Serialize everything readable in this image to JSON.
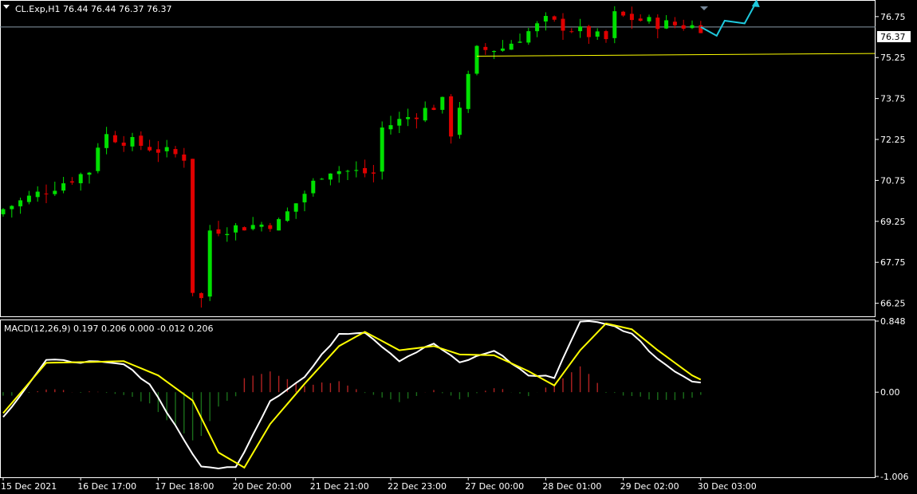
{
  "main_chart": {
    "header": "CL.Exp,H1  76.44 76.44 76.37 76.37",
    "price_axis_labels": [
      "76.75",
      "75.25",
      "73.75",
      "72.25",
      "70.75",
      "69.25",
      "67.75",
      "66.25"
    ],
    "current_price": "76.37",
    "current_price_badge_color": "#ffffff",
    "bid_line_color": "#8a9aa8",
    "support_line_color": "#ffff00",
    "forecast_arrow_color": "#1ec8dc"
  },
  "macd_panel": {
    "header": "MACD(12,26,9) 0.197 0.206 0.000 -0.012 0.206",
    "axis_labels": [
      "0.848",
      "0.00",
      "-1.006"
    ],
    "macd_line_color": "#ffffff",
    "signal_line_color": "#ffff00",
    "hist_positive_color": "#b22222",
    "hist_negative_color": "#1a6e1a"
  },
  "time_axis": {
    "labels": [
      "15 Dec 2021",
      "16 Dec 17:00",
      "17 Dec 18:00",
      "20 Dec 20:00",
      "21 Dec 21:00",
      "22 Dec 23:00",
      "27 Dec 00:00",
      "28 Dec 01:00",
      "29 Dec 02:00",
      "30 Dec 03:00"
    ]
  },
  "colors": {
    "background": "#000000",
    "bull_candle": "#00e000",
    "bear_candle": "#e00000",
    "axis": "#ffffff"
  },
  "chart_data": [
    {
      "type": "candlestick",
      "symbol": "CL.Exp",
      "timeframe": "H1",
      "title": "CL.Exp,H1",
      "ohlc_last": {
        "open": 76.44,
        "high": 76.44,
        "low": 76.37,
        "close": 76.37
      },
      "x_labels": [
        "15 Dec 2021",
        "16 Dec 17:00",
        "17 Dec 18:00",
        "20 Dec 20:00",
        "21 Dec 21:00",
        "22 Dec 23:00",
        "27 Dec 00:00",
        "28 Dec 01:00",
        "29 Dec 02:00",
        "30 Dec 03:00"
      ],
      "ylim": [
        65.8,
        77.3
      ],
      "y_ticks": [
        76.75,
        75.25,
        73.75,
        72.25,
        70.75,
        69.25,
        67.75,
        66.25
      ],
      "close_anchors": [
        {
          "x": "15 Dec 2021",
          "y": 69.7
        },
        {
          "x": "15 Dec 2021 +10h",
          "y": 71.1
        },
        {
          "x": "16 Dec 17:00",
          "y": 71.4
        },
        {
          "x": "16 Dec 17:00 +3h",
          "y": 72.4
        },
        {
          "x": "16 Dec 17:00 +12h",
          "y": 71.6
        },
        {
          "x": "17 Dec 18:00 -14h",
          "y": 70.7
        },
        {
          "x": "17 Dec 18:00 -4h",
          "y": 69.3
        },
        {
          "x": "17 Dec 18:00 +2h",
          "y": 67.4
        },
        {
          "x": "17 Dec 18:00 +5h",
          "y": 66.4
        },
        {
          "x": "20 Dec 20:00 -4h",
          "y": 68.9
        },
        {
          "x": "20 Dec 20:00 +5h",
          "y": 69.2
        },
        {
          "x": "20 Dec 20:00 +10h",
          "y": 71.0
        },
        {
          "x": "21 Dec 21:00",
          "y": 71.2
        },
        {
          "x": "21 Dec 21:00 +7h",
          "y": 71.0
        },
        {
          "x": "22 Dec 23:00 -6h",
          "y": 72.9
        },
        {
          "x": "22 Dec 23:00 -3h",
          "y": 72.4
        },
        {
          "x": "22 Dec 23:00 +6h",
          "y": 73.6
        },
        {
          "x": "27 Dec 00:00 -7h",
          "y": 72.8
        },
        {
          "x": "27 Dec 00:00 -2h",
          "y": 72.5
        },
        {
          "x": "27 Dec 00:00 +1h",
          "y": 75.5
        },
        {
          "x": "28 Dec 01:00 -5h",
          "y": 75.6
        },
        {
          "x": "28 Dec 01:00",
          "y": 76.6
        },
        {
          "x": "28 Dec 01:00 +7h",
          "y": 75.9
        },
        {
          "x": "29 Dec 02:00 -4h",
          "y": 75.3
        },
        {
          "x": "29 Dec 02:00 -1h",
          "y": 76.8
        },
        {
          "x": "29 Dec 02:00 +4h",
          "y": 76.5
        },
        {
          "x": "30 Dec 03:00",
          "y": 76.37
        }
      ],
      "support_line": {
        "from": {
          "x": "27 Dec 00:00 +1h",
          "y": 75.3
        },
        "to": {
          "x": "30 Dec 03:00 +60h",
          "y": 75.4
        }
      },
      "forecast_path": [
        76.37,
        76.05,
        76.6,
        76.5,
        77.3
      ]
    },
    {
      "type": "line",
      "title": "MACD(12,26,9)",
      "values_last": {
        "macd": 0.197,
        "signal": 0.206,
        "value3": 0.0,
        "value4": -0.012,
        "value5": 0.206
      },
      "ylim": [
        -1.006,
        0.848
      ],
      "y_ticks": [
        0.848,
        0.0,
        -1.006
      ],
      "series": [
        {
          "name": "MACD",
          "anchors": [
            [
              0,
              -0.3
            ],
            [
              5,
              0.38
            ],
            [
              10,
              0.36
            ],
            [
              14,
              0.33
            ],
            [
              17,
              0.1
            ],
            [
              20,
              -0.4
            ],
            [
              23,
              -0.9
            ],
            [
              27,
              -0.9
            ],
            [
              31,
              -0.1
            ],
            [
              35,
              0.18
            ],
            [
              39,
              0.7
            ],
            [
              42,
              0.72
            ],
            [
              46,
              0.38
            ],
            [
              50,
              0.58
            ],
            [
              53,
              0.35
            ],
            [
              57,
              0.5
            ],
            [
              61,
              0.2
            ],
            [
              64,
              0.18
            ],
            [
              67,
              0.85
            ],
            [
              70,
              0.82
            ],
            [
              73,
              0.7
            ],
            [
              76,
              0.4
            ],
            [
              80,
              0.12
            ],
            [
              83,
              0.12
            ],
            [
              86,
              0.2
            ],
            [
              88,
              0.22
            ]
          ]
        },
        {
          "name": "Signal",
          "anchors": [
            [
              0,
              -0.25
            ],
            [
              5,
              0.35
            ],
            [
              10,
              0.36
            ],
            [
              14,
              0.37
            ],
            [
              18,
              0.2
            ],
            [
              22,
              -0.1
            ],
            [
              25,
              -0.72
            ],
            [
              28,
              -0.9
            ],
            [
              31,
              -0.38
            ],
            [
              35,
              0.1
            ],
            [
              39,
              0.55
            ],
            [
              42,
              0.72
            ],
            [
              46,
              0.5
            ],
            [
              50,
              0.55
            ],
            [
              53,
              0.45
            ],
            [
              57,
              0.44
            ],
            [
              61,
              0.25
            ],
            [
              64,
              0.08
            ],
            [
              67,
              0.5
            ],
            [
              70,
              0.82
            ],
            [
              73,
              0.75
            ],
            [
              76,
              0.5
            ],
            [
              80,
              0.2
            ],
            [
              83,
              0.05
            ],
            [
              86,
              0.18
            ],
            [
              88,
              0.2
            ]
          ]
        }
      ]
    }
  ]
}
